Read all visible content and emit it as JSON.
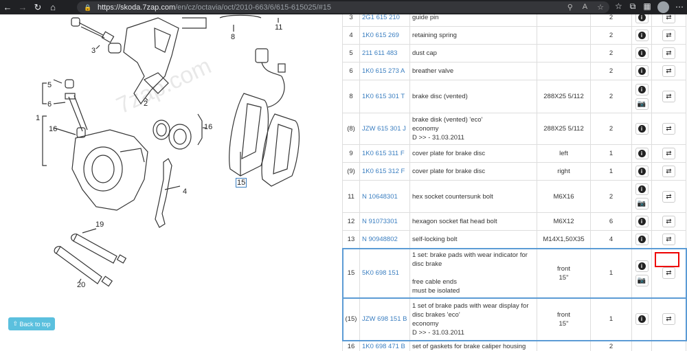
{
  "browser": {
    "url_host": "https://skoda.7zap.com",
    "url_path": "/en/cz/octavia/oct/2010-663/6/615-615025/#15"
  },
  "diagram": {
    "watermark": "7zap.com",
    "callouts": {
      "c3": "3",
      "c2": "2",
      "c8": "8",
      "c11": "11",
      "c5": "5",
      "c6": "6",
      "c1": "1",
      "c16a": "16",
      "c16b": "16",
      "c4": "4",
      "c15": "15",
      "c19": "19",
      "c20": "20"
    },
    "back_to_top": "Back to top"
  },
  "table": {
    "rows": [
      {
        "pos": "3",
        "number": "2G1 615 210",
        "name": "guide pin",
        "spec": "",
        "qty": "2",
        "info": true,
        "cam": false,
        "swap": true
      },
      {
        "pos": "4",
        "number": "1K0 615 269",
        "name": "retaining spring",
        "spec": "",
        "qty": "2",
        "info": true,
        "cam": false,
        "swap": true
      },
      {
        "pos": "5",
        "number": "211 611 483",
        "name": "dust cap",
        "spec": "",
        "qty": "2",
        "info": true,
        "cam": false,
        "swap": true
      },
      {
        "pos": "6",
        "number": "1K0 615 273 A",
        "name": "breather valve",
        "spec": "",
        "qty": "2",
        "info": true,
        "cam": false,
        "swap": true
      },
      {
        "pos": "8",
        "number": "1K0 615 301 T",
        "name": "brake disc (vented)",
        "spec": "288X25 5/112",
        "qty": "2",
        "info": true,
        "cam": true,
        "swap": true
      },
      {
        "pos": "(8)",
        "number": "JZW 615 301 J",
        "name": "brake disk (vented) 'eco'\neconomy\nD >> - 31.03.2011",
        "spec": "288X25 5/112",
        "qty": "2",
        "info": true,
        "cam": false,
        "swap": true
      },
      {
        "pos": "9",
        "number": "1K0 615 311 F",
        "name": "cover plate for brake disc",
        "spec": "left",
        "qty": "1",
        "info": true,
        "cam": false,
        "swap": true
      },
      {
        "pos": "(9)",
        "number": "1K0 615 312 F",
        "name": "cover plate for brake disc",
        "spec": "right",
        "qty": "1",
        "info": true,
        "cam": false,
        "swap": true
      },
      {
        "pos": "11",
        "number": "N  10648301",
        "name": "hex socket countersunk bolt",
        "spec": "M6X16",
        "qty": "2",
        "info": true,
        "cam": true,
        "swap": true
      },
      {
        "pos": "12",
        "number": "N  91073301",
        "name": "hexagon socket flat head bolt",
        "spec": "M6X12",
        "qty": "6",
        "info": true,
        "cam": false,
        "swap": true
      },
      {
        "pos": "13",
        "number": "N  90948802",
        "name": "self-locking bolt",
        "spec": "M14X1,50X35",
        "qty": "4",
        "info": true,
        "cam": false,
        "swap": true
      },
      {
        "pos": "15",
        "number": "5K0 698 151",
        "name": "1 set: brake pads with wear indicator for disc brake\n\nfree cable ends\nmust be isolated",
        "spec": "front\n15\"",
        "qty": "1",
        "info": true,
        "cam": true,
        "swap": true,
        "selected": true
      },
      {
        "pos": "(15)",
        "number": "JZW 698 151 B",
        "name": "1 set of brake pads with wear display for disc brakes 'eco'\neconomy\nD >> - 31.03.2011",
        "spec": "front\n15\"",
        "qty": "1",
        "info": true,
        "cam": false,
        "swap": true,
        "selected": true
      },
      {
        "pos": "16",
        "number": "1K0 698 471 B",
        "name": "set of gaskets for brake caliper housing",
        "spec": "",
        "qty": "2",
        "info": false,
        "cam": false,
        "swap": false
      }
    ]
  }
}
